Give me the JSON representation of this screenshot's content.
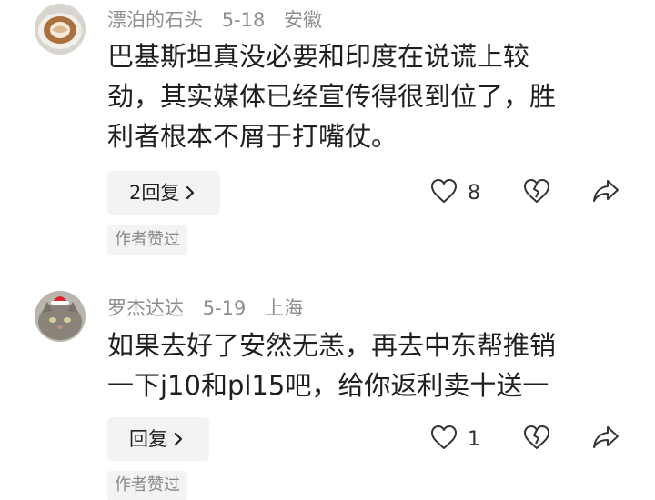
{
  "comments": [
    {
      "username": "漂泊的石头",
      "date": "5-18",
      "location": "安徽",
      "content_lines": [
        "巴基斯坦真没必要和印度在说谎上较",
        "劲，其实媒体已经宣传得很到位了，胜",
        "利者根本不屑于打嘴仗。"
      ],
      "reply_label": "2回复",
      "like_count": "8",
      "author_badge": "作者赞过",
      "avatar_icon": "latte-art-avatar"
    },
    {
      "username": "罗杰达达",
      "date": "5-19",
      "location": "上海",
      "content_lines": [
        "如果去好了安然无恙，再去中东帮推销",
        "一下j10和pl15吧，给你返利卖十送一"
      ],
      "reply_label": "回复",
      "like_count": "1",
      "author_badge": "作者赞过",
      "avatar_icon": "cat-with-santa-hat-avatar"
    }
  ],
  "icons": {
    "like": "heart-outline-icon",
    "dislike": "broken-heart-icon",
    "share": "share-arrow-icon",
    "chevron": "chevron-right-icon"
  },
  "colors": {
    "meta_text": "#8e8e8e",
    "button_bg": "#f3f3f3",
    "icon_stroke": "#333333"
  }
}
